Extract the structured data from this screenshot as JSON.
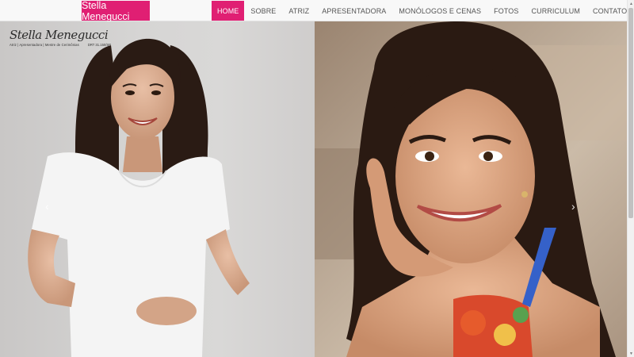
{
  "navbar": {
    "brand": "Stella Menegucci",
    "items": [
      {
        "label": "HOME",
        "active": true
      },
      {
        "label": "SOBRE"
      },
      {
        "label": "ATRIZ"
      },
      {
        "label": "APRESENTADORA"
      },
      {
        "label": "MONÓLOGOS E CENAS"
      },
      {
        "label": "FOTOS"
      },
      {
        "label": "CURRICULUM"
      },
      {
        "label": "CONTATO"
      }
    ],
    "accent_color": "#e01f73"
  },
  "hero": {
    "logo_script": "Stella Menegucci",
    "logo_subtitle": "Atriz | Apresentadora | Mestre de Cerimônias",
    "logo_registration": "DRT 31.150/SP",
    "prev_arrow": "‹",
    "next_arrow": "›"
  },
  "icons": {
    "prev": "chevron-left-icon",
    "next": "chevron-right-icon"
  }
}
